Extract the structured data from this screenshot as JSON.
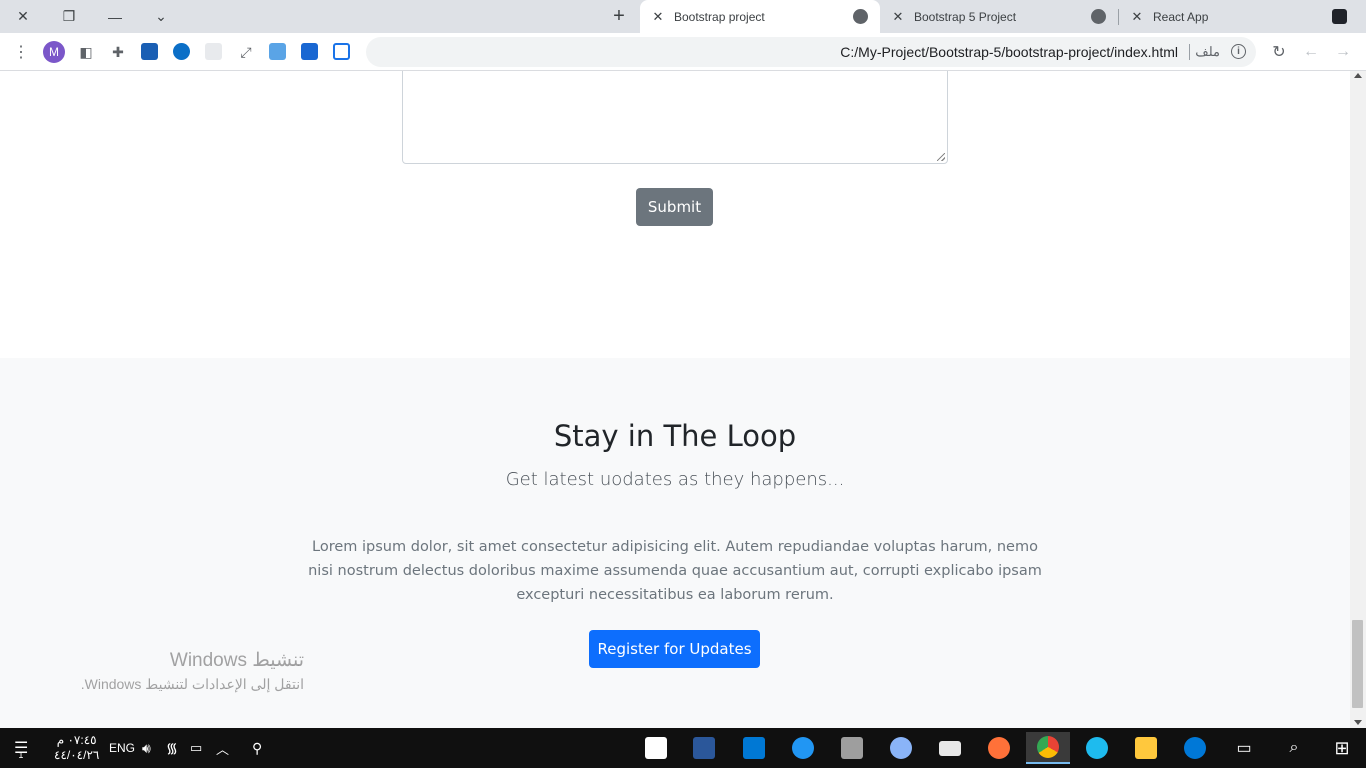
{
  "browser": {
    "tabs": [
      {
        "title": "Bootstrap project",
        "active": true
      },
      {
        "title": "Bootstrap 5 Project",
        "active": false
      },
      {
        "title": "React App",
        "active": false
      }
    ],
    "profile_initial": "M",
    "url": "C:/My-Project/Bootstrap-5/bootstrap-project/index.html",
    "file_chip": "ملف"
  },
  "page": {
    "submit_label": "Submit",
    "newsletter": {
      "title": "Stay in The Loop",
      "subtitle": "Get latest uodates as they happens...",
      "body": "Lorem ipsum dolor, sit amet consectetur adipisicing elit. Autem repudiandae voluptas harum, nemo nisi nostrum delectus doloribus maxime assumenda quae accusantium aut, corrupti explicabo ipsam excepturi necessitatibus ea laborum rerum.",
      "register_label": "Register for Updates"
    }
  },
  "watermark": {
    "title": "تنشيط Windows",
    "subtitle": "انتقل إلى الإعدادات لتنشيط Windows."
  },
  "taskbar": {
    "time": "٠٧:٤٥ م",
    "date": "٤٤/٠٤/٢٦",
    "language": "ENG",
    "notification_count": "1"
  },
  "colors": {
    "primary": "#0d6efd",
    "secondary": "#6c757d",
    "section_bg": "#f8f9fa"
  }
}
